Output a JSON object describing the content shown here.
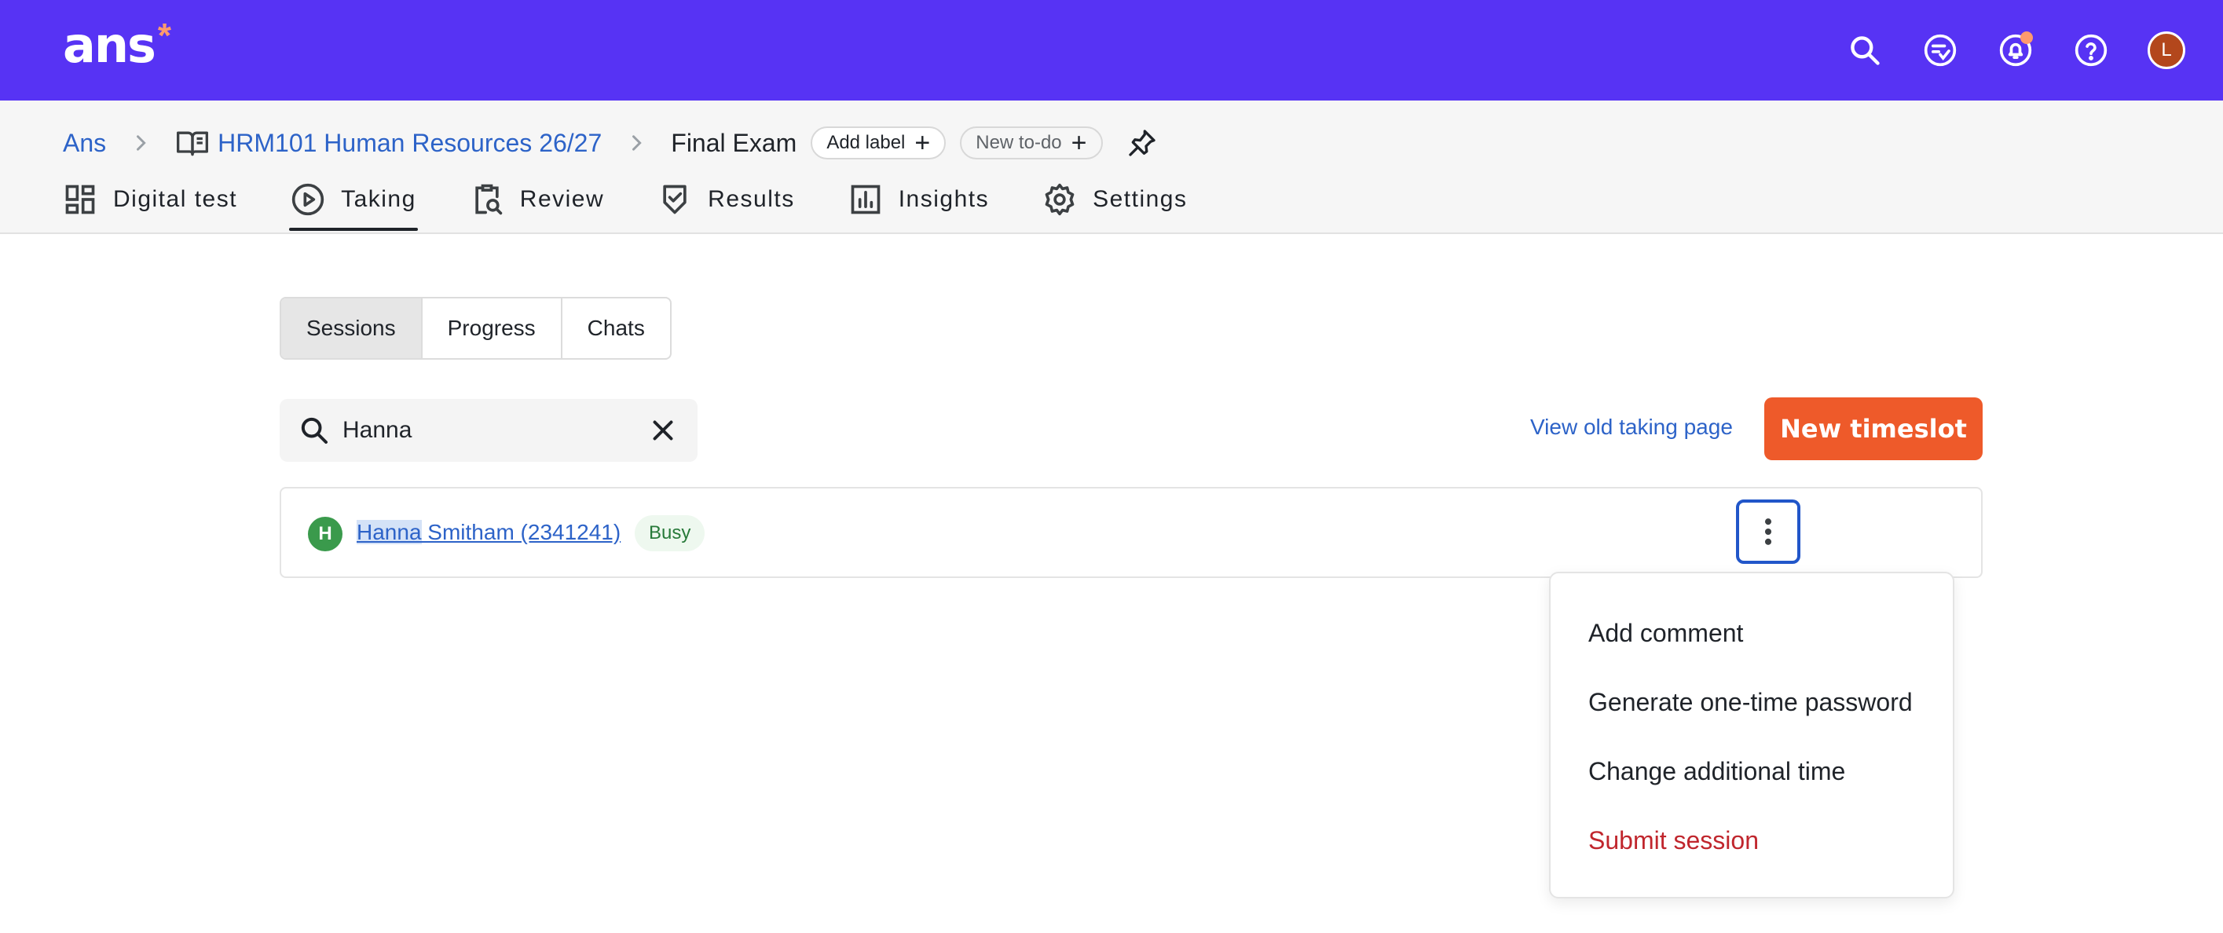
{
  "brand": {
    "logo_text": "ans",
    "logo_star": "*",
    "color_primary": "#5733f4",
    "color_accent": "#ee5a2a"
  },
  "top_icons": [
    {
      "name": "search-icon"
    },
    {
      "name": "todo-icon"
    },
    {
      "name": "bell-icon"
    },
    {
      "name": "help-icon"
    }
  ],
  "user": {
    "initial": "L"
  },
  "breadcrumb": {
    "root": "Ans",
    "course": "HRM101 Human Resources 26/27",
    "current": "Final Exam",
    "add_label": "Add label",
    "new_todo": "New to-do"
  },
  "tabs": [
    {
      "label": "Digital test",
      "icon": "dashboard-icon"
    },
    {
      "label": "Taking",
      "icon": "play-circle-icon",
      "active": true
    },
    {
      "label": "Review",
      "icon": "clipboard-search-icon"
    },
    {
      "label": "Results",
      "icon": "shield-check-icon"
    },
    {
      "label": "Insights",
      "icon": "bar-chart-icon"
    },
    {
      "label": "Settings",
      "icon": "gear-icon"
    }
  ],
  "segments": [
    "Sessions",
    "Progress",
    "Chats"
  ],
  "search": {
    "value": "Hanna",
    "placeholder": ""
  },
  "actions": {
    "old_page": "View old taking page",
    "new_timeslot": "New timeslot"
  },
  "session": {
    "initial": "H",
    "name_highlight": "Hanna",
    "name_rest": " Smitham (2341241)",
    "status": "Busy"
  },
  "menu": {
    "items": [
      "Add comment",
      "Generate one-time password",
      "Change additional time"
    ],
    "danger_item": "Submit session"
  }
}
